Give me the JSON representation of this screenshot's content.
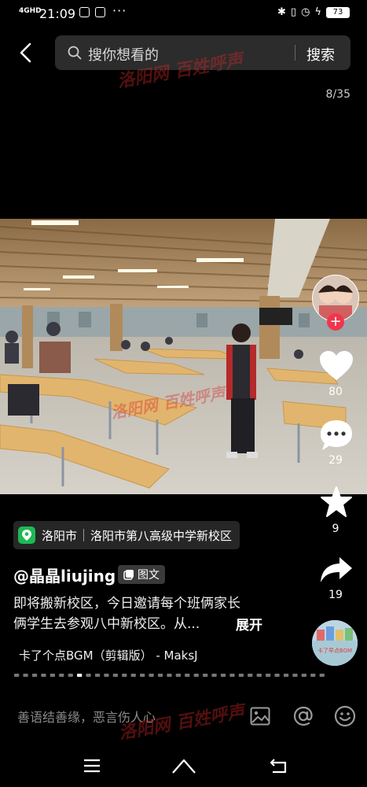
{
  "status_bar": {
    "network": "4GHD",
    "time": "21:09",
    "battery": "73"
  },
  "search": {
    "placeholder": "搜你想看的",
    "button": "搜索"
  },
  "counter": "8/35",
  "watermark": "洛阳网 百姓呼声",
  "sidebar": {
    "likes": "80",
    "comments": "29",
    "favorites": "9",
    "shares": "19"
  },
  "location": {
    "city": "洛阳市",
    "place": "洛阳市第八高级中学新校区"
  },
  "author": {
    "username": "@晶晶liujing",
    "post_type": "图文"
  },
  "description": {
    "line1": "即将搬新校区，今日邀请每个班俩家长",
    "line2": "俩学生去参观八中新校区。从...",
    "expand": "展开"
  },
  "music": {
    "title": "卡了个点BGM（剪辑版） - MaksJ",
    "disc_label": "卡了早点BGM"
  },
  "comment_input": {
    "placeholder": "善语结善缘，恶言伤人心"
  },
  "colors": {
    "like_accent": "#f0364d",
    "location_pin": "#1db954"
  }
}
